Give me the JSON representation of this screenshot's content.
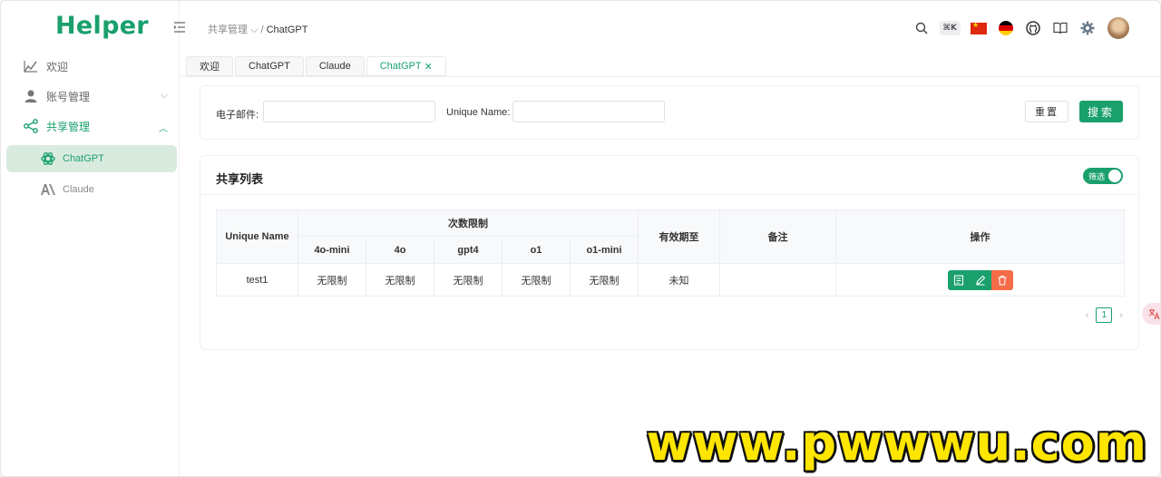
{
  "app": {
    "logo": "Helper"
  },
  "sidebar": {
    "items": [
      {
        "label": "欢迎",
        "icon": "chart-icon"
      },
      {
        "label": "账号管理",
        "icon": "user-icon"
      },
      {
        "label": "共享管理",
        "icon": "share-icon"
      }
    ],
    "subitems": [
      {
        "label": "ChatGPT",
        "icon": "openai-icon"
      },
      {
        "label": "Claude",
        "icon": "anthropic-icon"
      }
    ]
  },
  "breadcrumb": {
    "parent": "共享管理",
    "current": "ChatGPT"
  },
  "header": {
    "shortcut": "⌘K"
  },
  "tabs": [
    {
      "label": "欢迎"
    },
    {
      "label": "ChatGPT"
    },
    {
      "label": "Claude"
    },
    {
      "label": "ChatGPT",
      "close": "✕"
    }
  ],
  "search": {
    "email_label": "电子邮件:",
    "email_value": "",
    "unique_label": "Unique Name:",
    "unique_value": "",
    "reset_label": "重置",
    "search_label": "搜索"
  },
  "list": {
    "title": "共享列表",
    "filter_label": "筛选",
    "headers": {
      "unique_name": "Unique Name",
      "limits": "次数限制",
      "models": [
        "4o-mini",
        "4o",
        "gpt4",
        "o1",
        "o1-mini"
      ],
      "expiry": "有效期至",
      "remark": "备注",
      "actions": "操作"
    },
    "rows": [
      {
        "name": "test1",
        "limits": [
          "无限制",
          "无限制",
          "无限制",
          "无限制",
          "无限制"
        ],
        "expiry": "未知",
        "remark": ""
      }
    ],
    "page": "1"
  },
  "colors": {
    "primary": "#1aa06d",
    "danger": "#f56c49"
  },
  "watermark": "www.pwwwu.com"
}
